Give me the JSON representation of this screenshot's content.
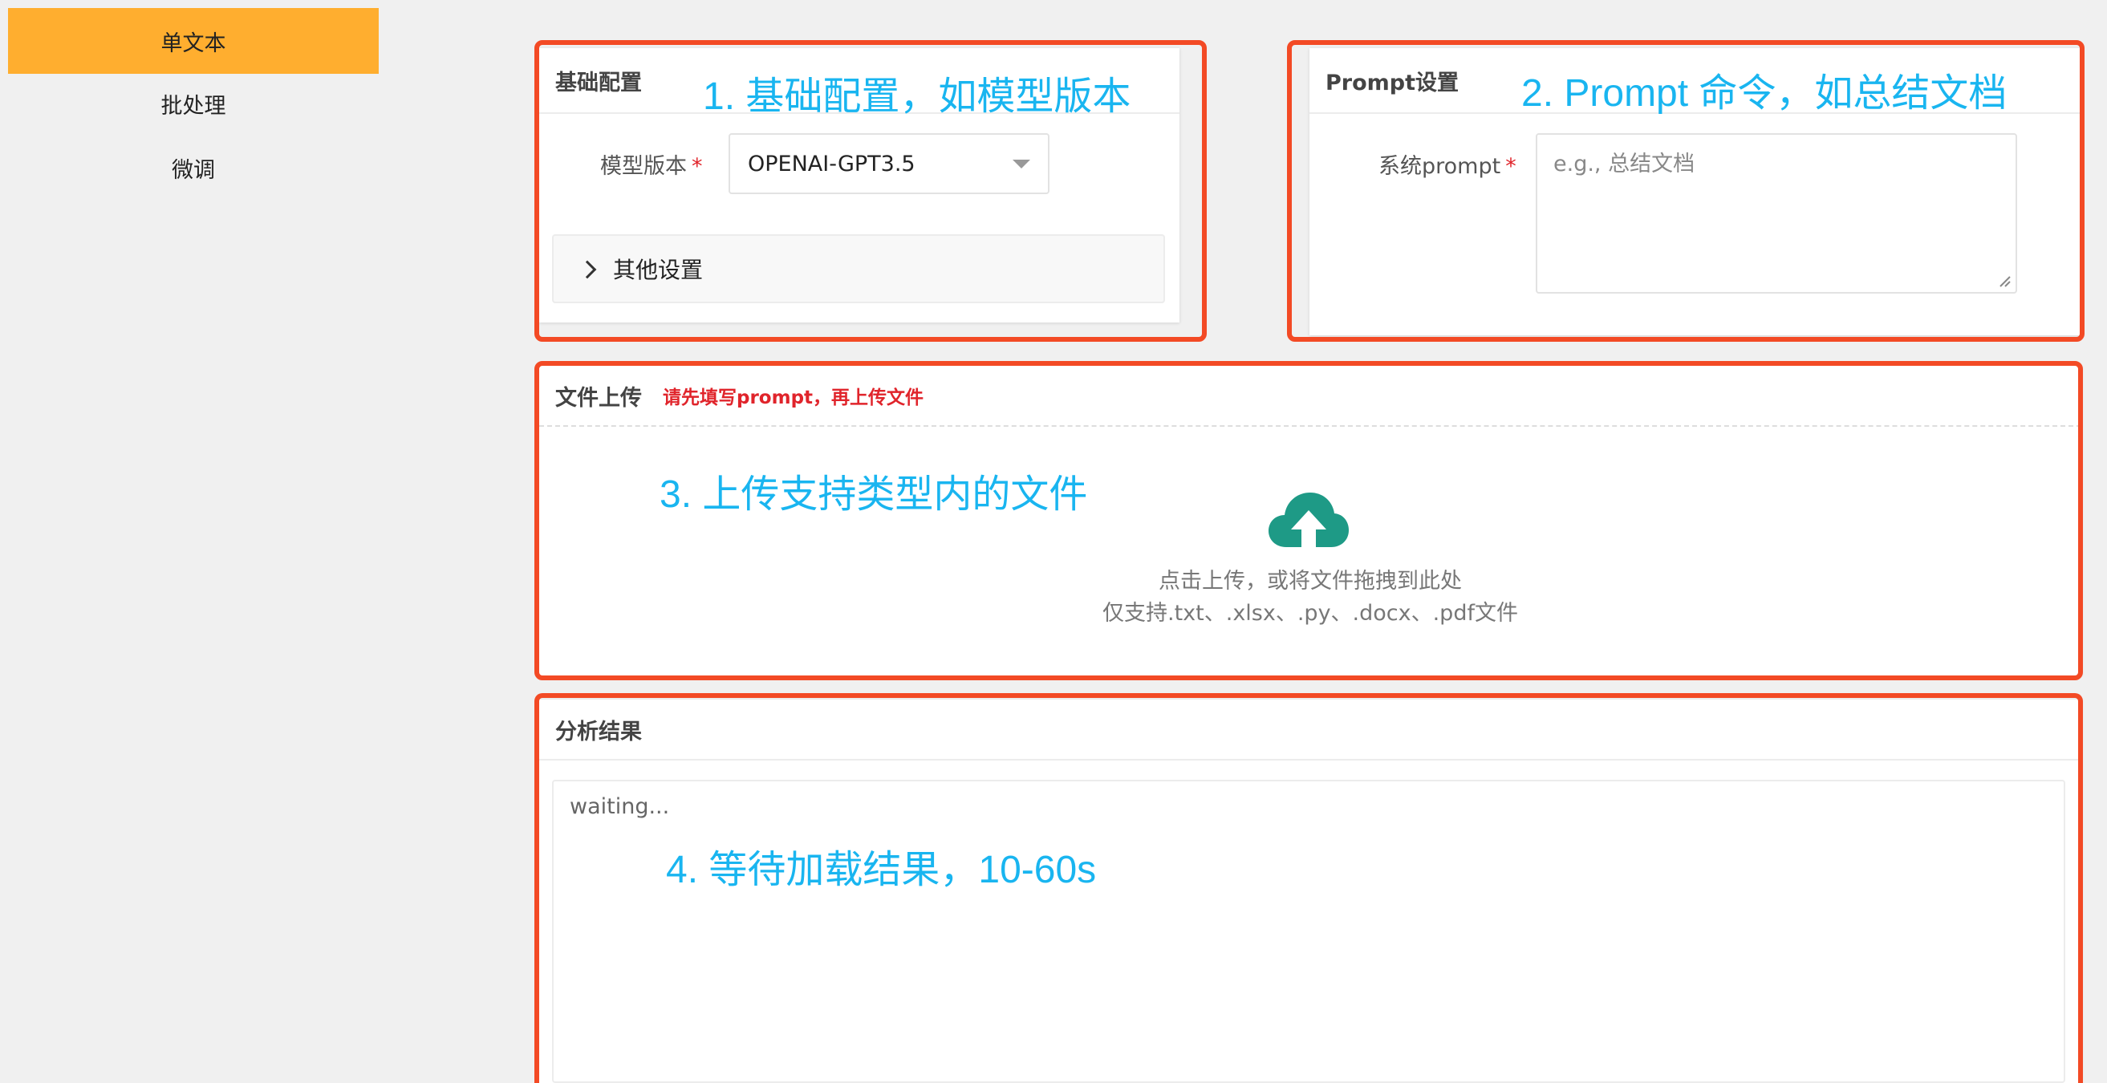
{
  "sidebar": {
    "items": [
      {
        "label": "单文本",
        "active": true
      },
      {
        "label": "批处理",
        "active": false
      },
      {
        "label": "微调",
        "active": false
      }
    ]
  },
  "basic_config": {
    "title": "基础配置",
    "model_label": "模型版本",
    "required_mark": "*",
    "model_value": "OPENAI-GPT3.5",
    "other_settings": "其他设置"
  },
  "prompt_settings": {
    "title": "Prompt设置",
    "system_prompt_label": "系统prompt",
    "required_mark": "*",
    "placeholder": "e.g., 总结文档"
  },
  "upload": {
    "title": "文件上传",
    "warning": "请先填写prompt，再上传文件",
    "hint_line1": "点击上传，或将文件拖拽到此处",
    "hint_line2": "仅支持.txt、.xlsx、.py、.docx、.pdf文件"
  },
  "result": {
    "title": "分析结果",
    "text": "waiting..."
  },
  "annotations": {
    "note1": "1. 基础配置，如模型版本",
    "note2": "2. Prompt 命令，如总结文档",
    "note3": "3. 上传支持类型内的文件",
    "note4": "4. 等待加载结果，10-60s"
  },
  "colors": {
    "accent": "#ffae2f",
    "annotation_frame": "#f34a25",
    "annotation_text": "#19b5f0",
    "upload_icon": "#1e9a86",
    "required": "#e0242b"
  },
  "icons": {
    "upload": "cloud-upload-icon",
    "expand": "chevron-right-icon",
    "dropdown": "caret-down-icon"
  }
}
